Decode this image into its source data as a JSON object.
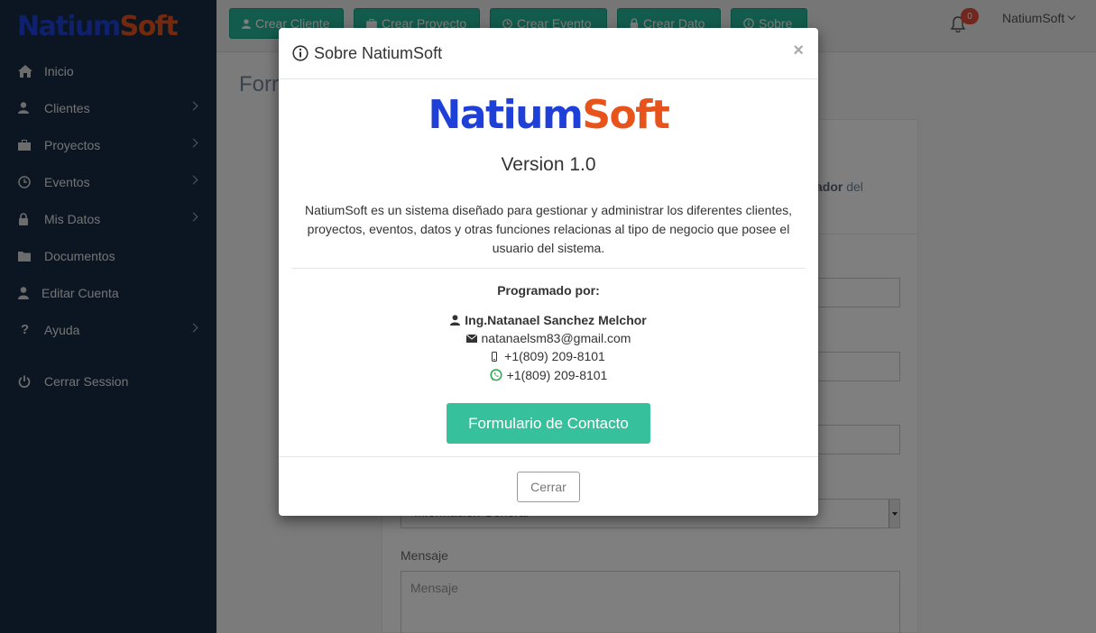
{
  "brand": {
    "part1": "Natium",
    "part2": "Soft"
  },
  "sidebar": {
    "items": [
      {
        "label": "Inicio",
        "icon": "home-icon",
        "has_submenu": false
      },
      {
        "label": "Clientes",
        "icon": "user-icon",
        "has_submenu": true
      },
      {
        "label": "Proyectos",
        "icon": "briefcase-icon",
        "has_submenu": true
      },
      {
        "label": "Eventos",
        "icon": "clock-icon",
        "has_submenu": true
      },
      {
        "label": "Mis Datos",
        "icon": "lock-icon",
        "has_submenu": true
      },
      {
        "label": "Documentos",
        "icon": "folder-icon",
        "has_submenu": false
      },
      {
        "label": "Editar Cuenta",
        "icon": "user-icon",
        "has_submenu": false
      },
      {
        "label": "Ayuda",
        "icon": "question-icon",
        "has_submenu": true
      }
    ],
    "logout": {
      "label": "Cerrar Session",
      "icon": "power-icon"
    }
  },
  "topbar": {
    "buttons": [
      {
        "label": "Crear Cliente",
        "icon": "user-icon"
      },
      {
        "label": "Crear Proyecto",
        "icon": "briefcase-icon"
      },
      {
        "label": "Crear Evento",
        "icon": "clock-icon"
      },
      {
        "label": "Crear Dato",
        "icon": "lock-icon"
      },
      {
        "label": "Sobre",
        "icon": "info-icon"
      }
    ],
    "notifications_count": "0",
    "user_name": "NatiumSoft"
  },
  "main": {
    "page_title_partial": "Forr",
    "intro_partial_bold": "ador",
    "intro_partial_rest": " del",
    "select_partial_value": "Información General",
    "message_label": "Mensaje",
    "message_placeholder": "Mensaje"
  },
  "modal": {
    "title": "Sobre NatiumSoft",
    "close_symbol": "×",
    "logo_part1": "Natium",
    "logo_part2": "Soft",
    "version": "Version 1.0",
    "description": "NatiumSoft es un sistema diseñado para gestionar y administrar los diferentes clientes, proyectos, eventos, datos y otras funciones relacionas al tipo de negocio que posee el usuario del sistema.",
    "programmed_by": "Programado por:",
    "author": "Ing.Natanael Sanchez Melchor",
    "email": "natanaelsm83@gmail.com",
    "phone": "+1(809) 209-8101",
    "whatsapp": "+1(809) 209-8101",
    "contact_button": "Formulario de Contacto",
    "close_button": "Cerrar"
  },
  "colors": {
    "sidebar_bg": "#172d44",
    "accent_green": "#26b99a",
    "brand_blue": "#1e40d8",
    "brand_orange": "#e8531b",
    "badge_red": "#e74c3c",
    "whatsapp_green": "#25a84a"
  }
}
